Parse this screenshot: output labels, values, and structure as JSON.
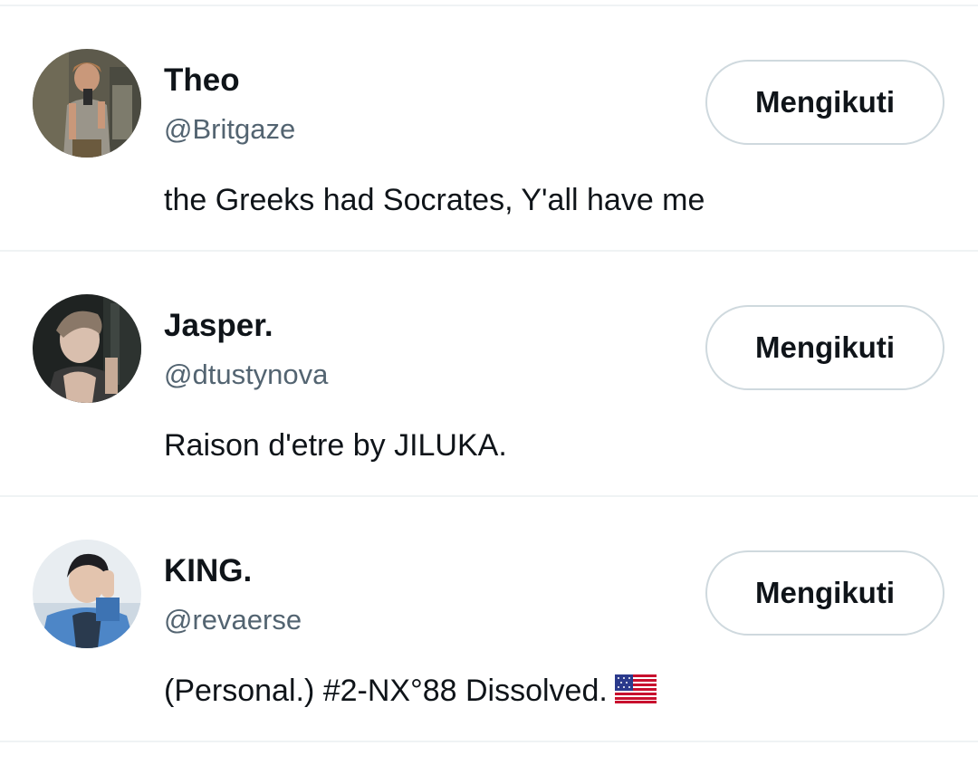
{
  "users": [
    {
      "display_name": "Theo",
      "handle": "@Britgaze",
      "bio": "the Greeks had Socrates, Y'all have me",
      "follow_label": "Mengikuti",
      "avatar_icon": "user-photo-avatar"
    },
    {
      "display_name": "Jasper.",
      "handle": "@dtustynova",
      "bio": "Raison d'etre by JILUKA.",
      "follow_label": "Mengikuti",
      "avatar_icon": "user-photo-avatar"
    },
    {
      "display_name": "KING.",
      "handle": "@revaerse",
      "bio": "(Personal.) #2-NX°88 Dissolved.",
      "bio_emoji": "us-flag-emoji",
      "follow_label": "Mengikuti",
      "avatar_icon": "user-photo-avatar"
    }
  ],
  "colors": {
    "text_primary": "#0f1419",
    "text_secondary": "#536471",
    "divider": "#eff3f4",
    "button_border": "#cfd9de"
  }
}
